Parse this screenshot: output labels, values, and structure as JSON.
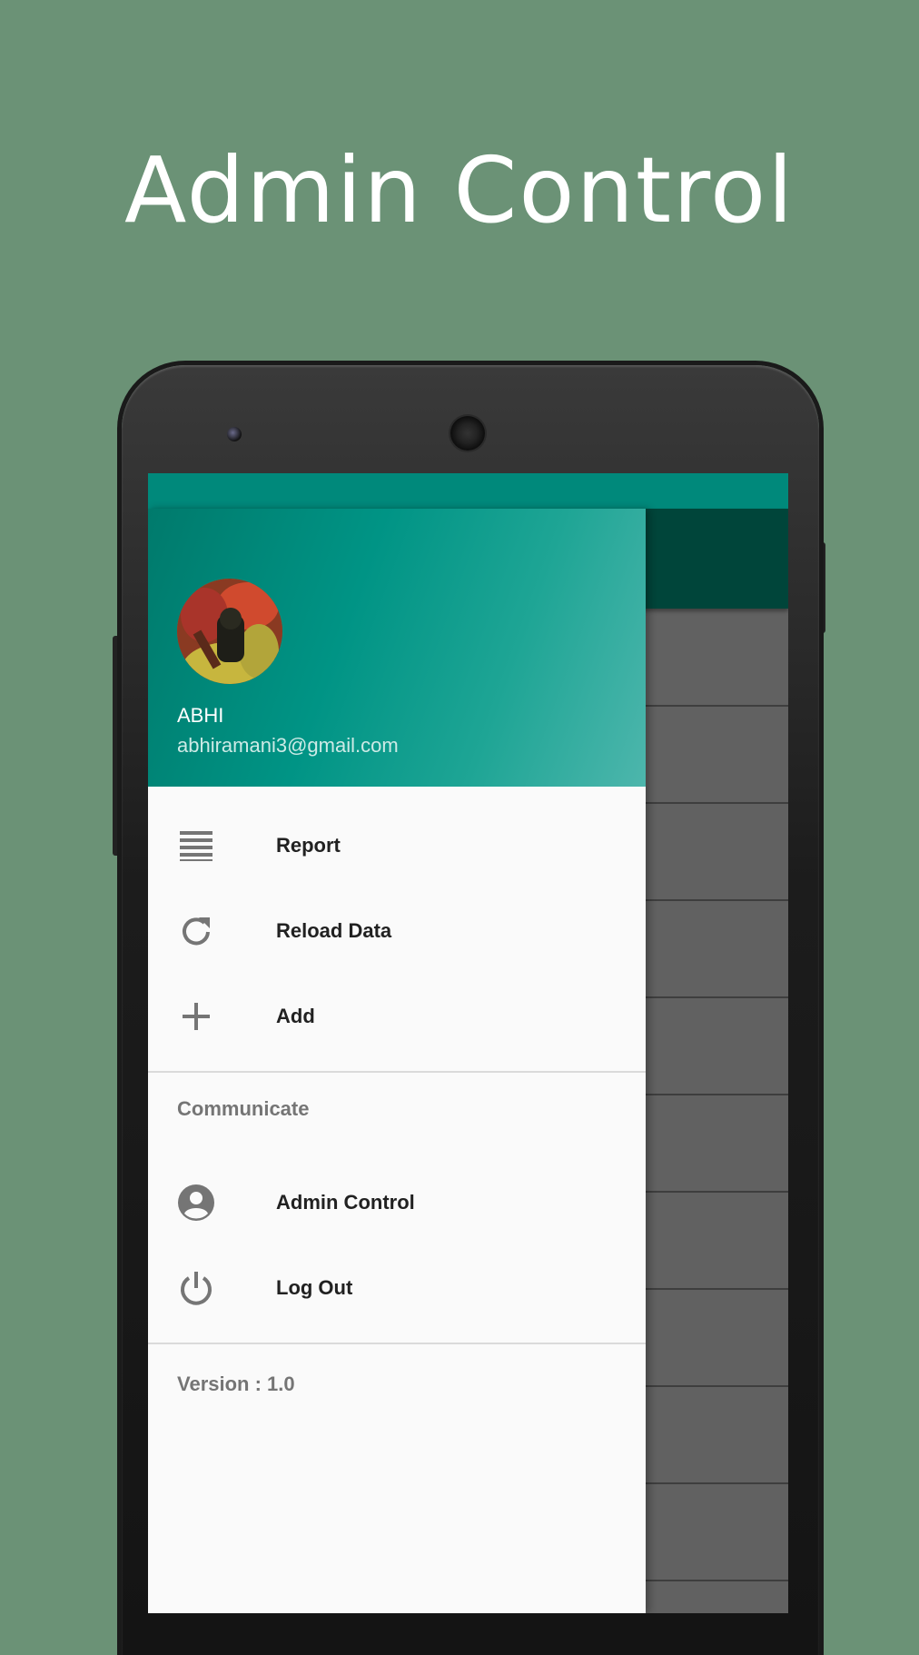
{
  "headline": "Admin Control",
  "drawer": {
    "user": {
      "name": "ABHI",
      "email": "abhiramani3@gmail.com"
    },
    "items": [
      {
        "label": "Report",
        "icon": "report-list-icon"
      },
      {
        "label": "Reload Data",
        "icon": "reload-icon"
      },
      {
        "label": "Add",
        "icon": "add-icon"
      }
    ],
    "section_title": "Communicate",
    "section_items": [
      {
        "label": "Admin Control",
        "icon": "account-circle-icon"
      },
      {
        "label": "Log Out",
        "icon": "power-icon"
      }
    ],
    "version": "Version : 1.0"
  },
  "colors": {
    "background": "#6b9276",
    "status_bar": "#00897b",
    "app_bar": "#00453a",
    "drawer_header_start": "#007a6c",
    "drawer_header_end": "#4db6ac",
    "icon_gray": "#757575"
  }
}
